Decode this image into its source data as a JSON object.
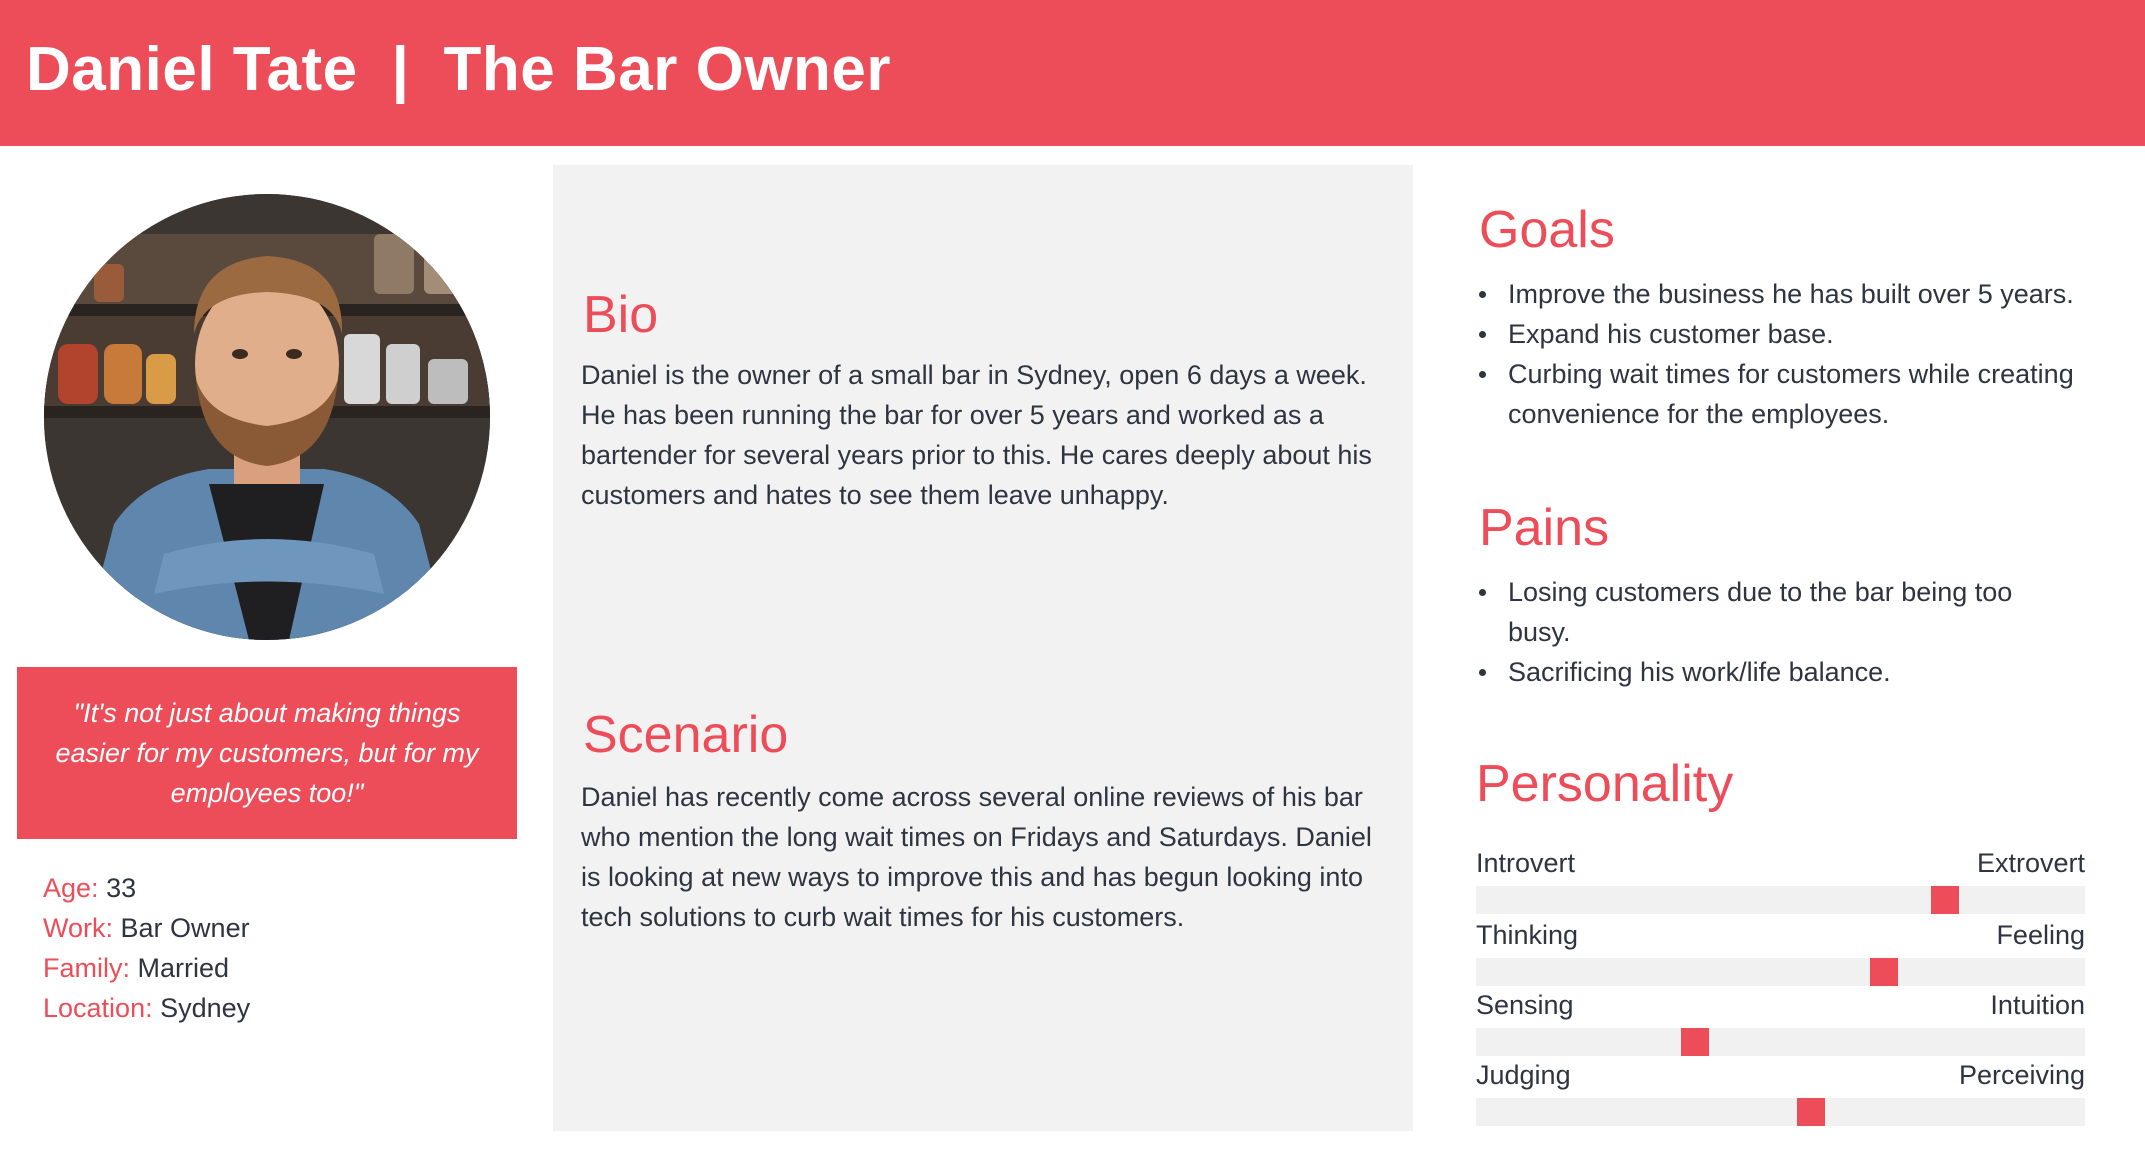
{
  "header": {
    "name": "Daniel Tate",
    "separator": "|",
    "role": "The Bar Owner"
  },
  "colors": {
    "accent": "#ec4d58",
    "text": "#2e3440",
    "panel": "#f2f2f2"
  },
  "profile": {
    "photo_icon": "portrait-photo",
    "quote": "\"It's not just about making things easier for my customers, but for my employees too!\"",
    "facts": [
      {
        "key": "Age:",
        "value": "33"
      },
      {
        "key": "Work:",
        "value": "Bar Owner"
      },
      {
        "key": "Family:",
        "value": "Married"
      },
      {
        "key": "Location:",
        "value": "Sydney"
      }
    ]
  },
  "bio": {
    "title": "Bio",
    "text": "Daniel is the owner of a small bar in Sydney, open 6 days a week. He has been running the bar for over 5 years and worked as a bartender for several years prior to this. He cares deeply about his customers and hates to see them leave unhappy."
  },
  "scenario": {
    "title": "Scenario",
    "text": "Daniel has recently come across several online reviews of his bar who mention the long wait times on Fridays and Saturdays. Daniel is looking at new ways to improve this and has begun looking into tech solutions to curb wait times for his customers."
  },
  "goals": {
    "title": "Goals",
    "items": [
      "Improve the business he has built over 5 years.",
      "Expand his customer base.",
      "Curbing wait times for customers while creating convenience for the employees."
    ]
  },
  "pains": {
    "title": "Pains",
    "items": [
      "Losing customers due to the bar being too busy.",
      "Sacrificing his work/life balance."
    ]
  },
  "personality": {
    "title": "Personality",
    "traits": [
      {
        "left": "Introvert",
        "right": "Extrovert",
        "value": 0.77
      },
      {
        "left": "Thinking",
        "right": "Feeling",
        "value": 0.67
      },
      {
        "left": "Sensing",
        "right": "Intuition",
        "value": 0.36
      },
      {
        "left": "Judging",
        "right": "Perceiving",
        "value": 0.55
      }
    ]
  }
}
